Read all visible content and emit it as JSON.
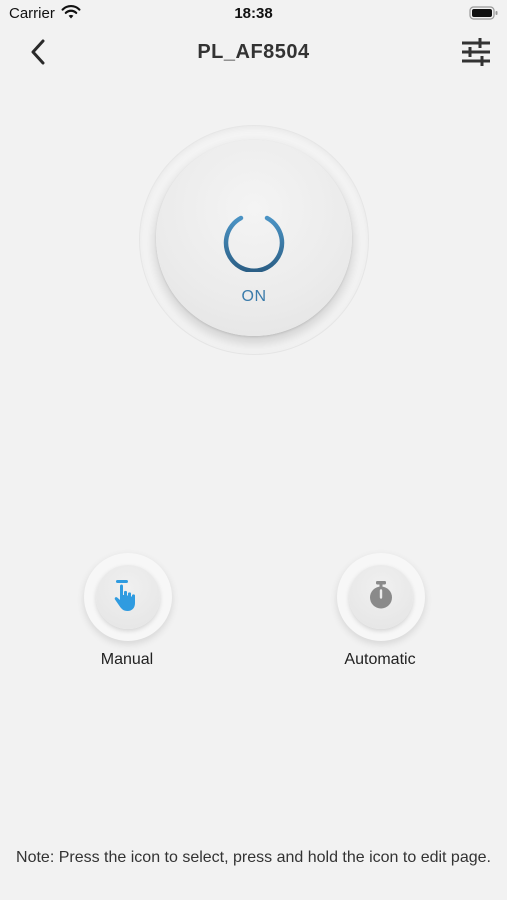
{
  "status_bar": {
    "carrier": "Carrier",
    "time": "18:38",
    "wifi_icon": "wifi-icon",
    "battery_icon": "battery-icon"
  },
  "nav": {
    "title": "PL_AF8504",
    "back_icon": "chevron-left-icon",
    "settings_icon": "sliders-icon"
  },
  "power": {
    "state_label": "ON",
    "icon": "power-icon",
    "color": "#3b7cab"
  },
  "modes": [
    {
      "label": "Manual",
      "icon": "hand-tap-icon",
      "color": "#2f9be0"
    },
    {
      "label": "Automatic",
      "icon": "stopwatch-icon",
      "color": "#8a8a8a"
    }
  ],
  "note": "Note: Press the icon to select, press and hold the icon to edit page."
}
